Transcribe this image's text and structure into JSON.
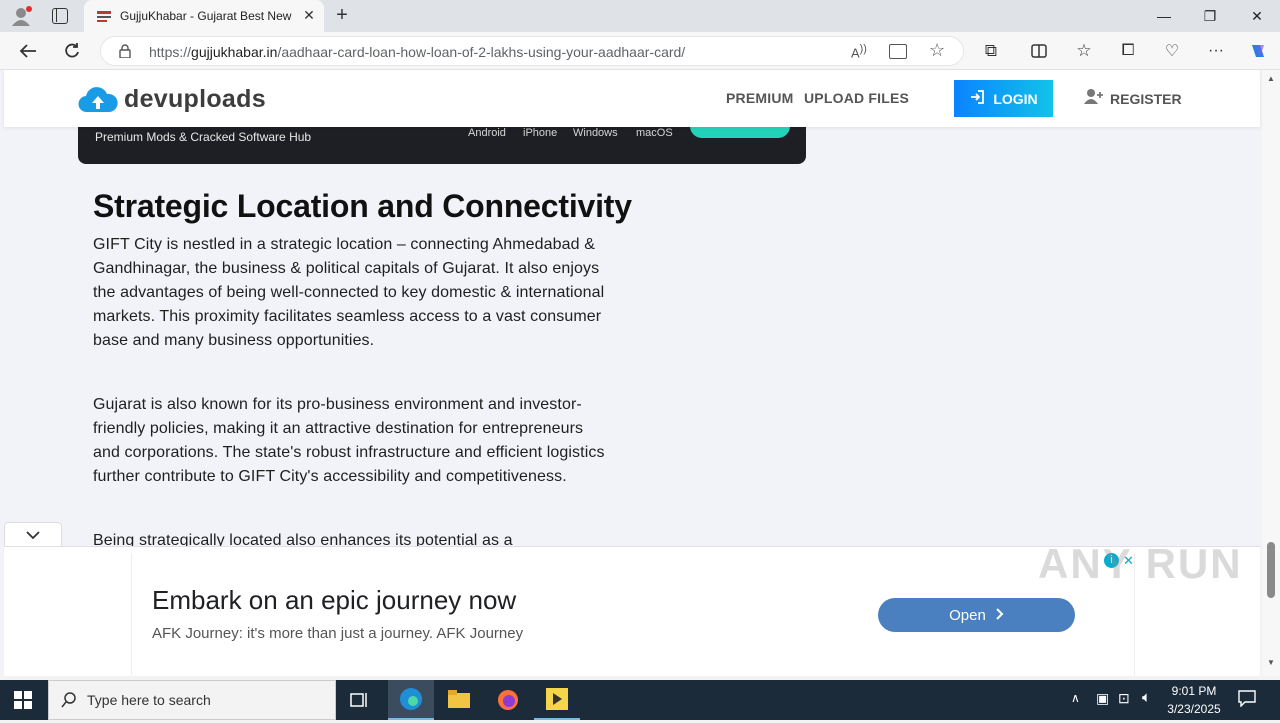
{
  "browser": {
    "tab_title": "GujjuKhabar - Gujarat Best News",
    "url_prefix": "https://",
    "url_host": "gujjukhabar.in",
    "url_path": "/aadhaar-card-loan-how-loan-of-2-lakhs-using-your-aadhaar-card/"
  },
  "site": {
    "logo": "devuploads",
    "nav": {
      "premium": "PREMIUM",
      "upload": "UPLOAD FILES",
      "login": "LOGIN",
      "register": "REGISTER"
    },
    "banner": {
      "tagline": "Premium Mods & Cracked Software Hub",
      "os": [
        "Android",
        "iPhone",
        "Windows",
        "macOS"
      ]
    }
  },
  "article": {
    "heading": "Strategic Location and Connectivity",
    "paragraphs": [
      "GIFT City is nestled in a strategic location – connecting Ahmedabad & Gandhinagar, the business & political capitals of Gujarat. It also enjoys the advantages of being well-connected to key domestic & international markets. This proximity facilitates seamless access to a vast consumer base and many business opportunities.",
      "Gujarat is also known for its pro-business environment and investor-friendly policies, making it an attractive destination for entrepreneurs and corporations. The state's robust infrastructure and efficient logistics further contribute to GIFT City's accessibility and competitiveness.",
      "Being strategically located also enhances its potential as a"
    ]
  },
  "ad": {
    "title": "Embark on an epic journey now",
    "subtitle": "AFK Journey: it's more than just a journey. AFK Journey",
    "button": "Open"
  },
  "watermark": "ANY RUN",
  "taskbar": {
    "search_placeholder": "Type here to search",
    "time": "9:01 PM",
    "date": "3/23/2025"
  },
  "colors": {
    "login_start": "#0a84ff",
    "login_end": "#12c2e9",
    "ad_button": "#4a7fc0",
    "taskbar": "#1c2b3a"
  }
}
